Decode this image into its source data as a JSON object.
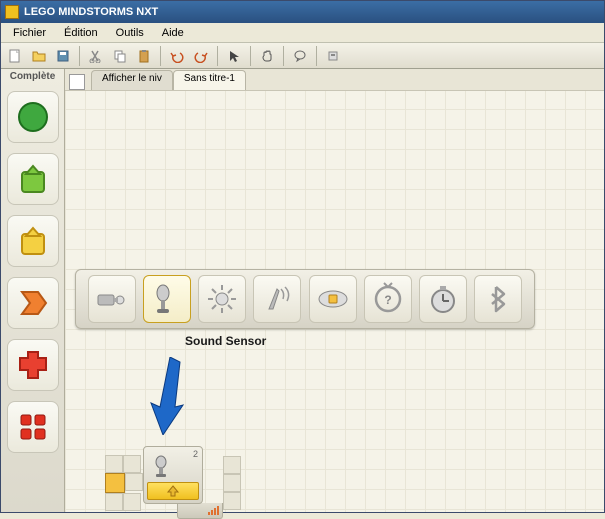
{
  "title": "LEGO MINDSTORMS NXT",
  "menu": {
    "file": "Fichier",
    "edit": "Édition",
    "tools": "Outils",
    "help": "Aide"
  },
  "palette_title": "Complète",
  "tabs": {
    "t1": "Afficher le niv",
    "t2": "Sans titre-1"
  },
  "sensor_label": "Sound Sensor",
  "block": {
    "port": "2"
  }
}
